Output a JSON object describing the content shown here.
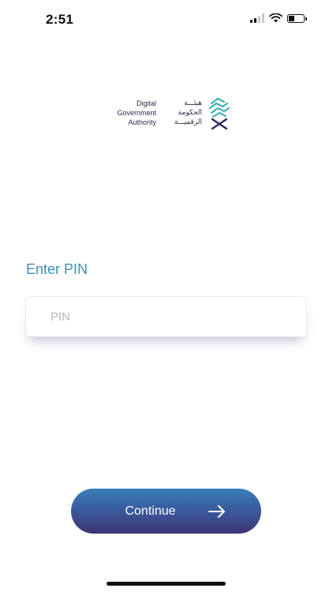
{
  "status_bar": {
    "time": "2:51",
    "battery_level": 0.4,
    "signal_bars": 2
  },
  "logo": {
    "english_lines": [
      "Digital",
      "Government",
      "Authority"
    ],
    "arabic_lines": [
      "هيئـــة",
      "الحكومة",
      "الرقميـــة"
    ],
    "mark_icon": "dga-logo-icon",
    "colors": {
      "teal": "#3bb3b5",
      "navy": "#2f2a5e"
    }
  },
  "pin": {
    "label": "Enter PIN",
    "placeholder": "PIN",
    "value": ""
  },
  "continue_button": {
    "label": "Continue",
    "icon": "arrow-right-icon"
  },
  "colors": {
    "accent_label": "#3d8fb3",
    "button_gradient_top": "#3a7fb5",
    "button_gradient_bottom": "#3f3474"
  }
}
